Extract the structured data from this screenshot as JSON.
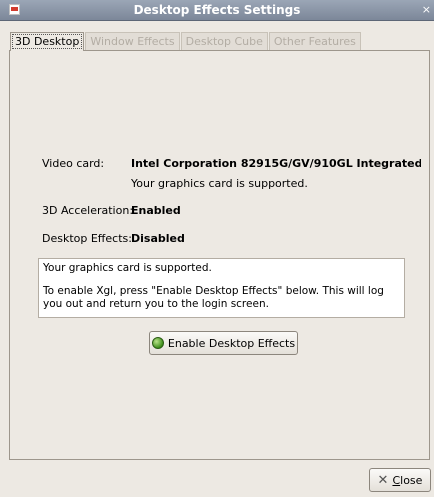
{
  "window": {
    "title": "Desktop Effects Settings",
    "close_glyph": "×"
  },
  "tabs": [
    {
      "label": "3D Desktop",
      "active": true
    },
    {
      "label": "Window Effects",
      "active": false
    },
    {
      "label": "Desktop Cube",
      "active": false
    },
    {
      "label": "Other Features",
      "active": false
    }
  ],
  "video_card": {
    "label": "Video card:",
    "value": "Intel Corporation 82915G/GV/910GL Integrated ...",
    "status": "Your graphics card is supported."
  },
  "acceleration": {
    "label": "3D Acceleration:",
    "value": "Enabled"
  },
  "effects": {
    "label": "Desktop Effects:",
    "value": "Disabled"
  },
  "infobox": {
    "line1": "Your graphics card is supported.",
    "line2": "To enable Xgl, press \"Enable Desktop Effects\" below. This will log you out and return you to the login screen."
  },
  "buttons": {
    "enable_label": "Enable Desktop Effects",
    "close_first_letter": "C",
    "close_rest": "lose"
  },
  "icons": {
    "app_icon": "app-icon",
    "enable_icon": "green-ball-icon",
    "close_icon": "close-x-icon"
  }
}
